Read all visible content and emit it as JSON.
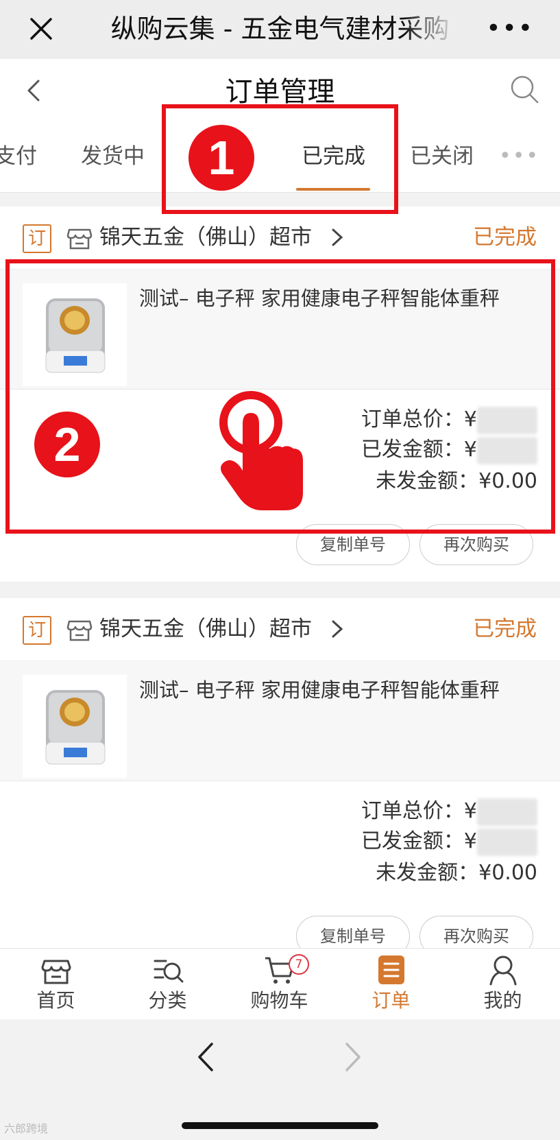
{
  "window": {
    "title": "纵购云集 - 五金电气建材采购",
    "more_label": "•••"
  },
  "header": {
    "title": "订单管理"
  },
  "tabs": {
    "items": [
      "支付",
      "发货中",
      "已完成",
      "已关闭"
    ],
    "active": "已完成",
    "more_label": "•••"
  },
  "orders": [
    {
      "badge": "订",
      "shop_name": "锦天五金（佛山）超市",
      "status": "已完成",
      "product_title": "测试– 电子秤 家用健康电子秤智能体重秤",
      "total_label": "订单总价：¥",
      "shipped_label": "已发金额：¥",
      "unshipped_label": "未发金额：¥0.00",
      "copy_button": "复制单号",
      "rebuy_button": "再次购买"
    },
    {
      "badge": "订",
      "shop_name": "锦天五金（佛山）超市",
      "status": "已完成",
      "product_title": "测试– 电子秤 家用健康电子秤智能体重秤",
      "total_label": "订单总价：¥",
      "shipped_label": "已发金额：¥",
      "unshipped_label": "未发金额：¥0.00",
      "copy_button": "复制单号",
      "rebuy_button": "再次购买"
    }
  ],
  "annotations": {
    "step1": "1",
    "step2": "2"
  },
  "bottom_nav": {
    "items": [
      "首页",
      "分类",
      "购物车",
      "订单",
      "我的"
    ],
    "active": "订单",
    "cart_count": "7"
  },
  "watermark": "六郎跨境",
  "colors": {
    "accent": "#d4782f",
    "annotation_red": "#e8121a"
  }
}
